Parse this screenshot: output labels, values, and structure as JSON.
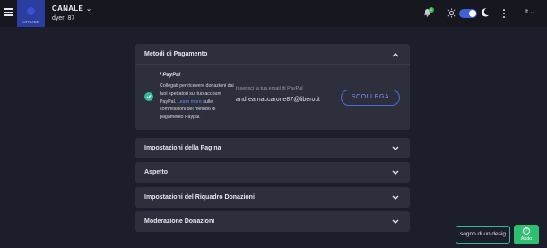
{
  "header": {
    "status_label": "OFFLINE",
    "channel_label": "CANALE",
    "username": "dyer_87",
    "notification_count": "1",
    "language": "It"
  },
  "colors": {
    "accent": "#3e62d8",
    "success": "#37b8a3",
    "help_green": "#2fbf71",
    "background": "#1d1e2c",
    "panel": "#2e2f3d"
  },
  "payment": {
    "title": "Metodi di Pagamento",
    "provider": "PayPal",
    "description_parts": {
      "before_link": "Collegati per ricevere donazioni dai tuoi spettatori sul tuo account PayPal.",
      "link": "Learn more",
      "after_link": "sulle commissioni del metodo di pagamento Paypal."
    },
    "email_label": "Inserisci la tua email di PayPal",
    "email_value": "andreamaccarone87@libero.it",
    "connect_button": "SCOLLEGA"
  },
  "sections": [
    {
      "title": "Impostazioni della Pagina"
    },
    {
      "title": "Aspetto"
    },
    {
      "title": "Impostazioni del Riquadro Donazioni"
    },
    {
      "title": "Moderazione Donazioni"
    }
  ],
  "footer": {
    "design_button": "sogno di un desig",
    "help_button": "Aiuto",
    "help_icon_glyph": "?"
  }
}
